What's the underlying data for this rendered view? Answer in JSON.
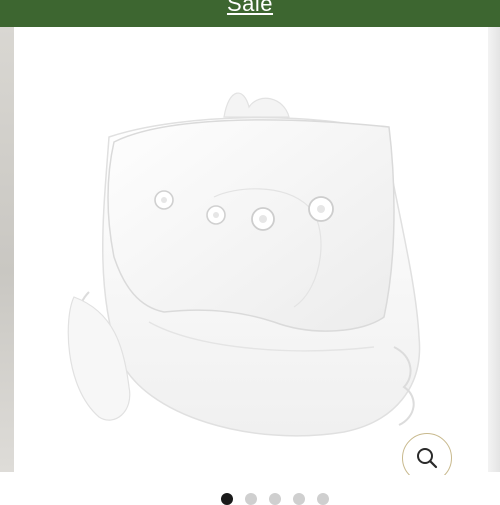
{
  "banner": {
    "link_text": "Sale"
  },
  "gallery": {
    "product_image": "white-cloth-diaper-snap",
    "zoom_icon": "magnifier-icon",
    "dots_count": 5,
    "active_index": 0
  },
  "colors": {
    "banner_bg": "#3d6630",
    "zoom_border": "#c8b98d",
    "dot_active": "#1a1a1a",
    "dot_inactive": "#cfcfcf"
  }
}
